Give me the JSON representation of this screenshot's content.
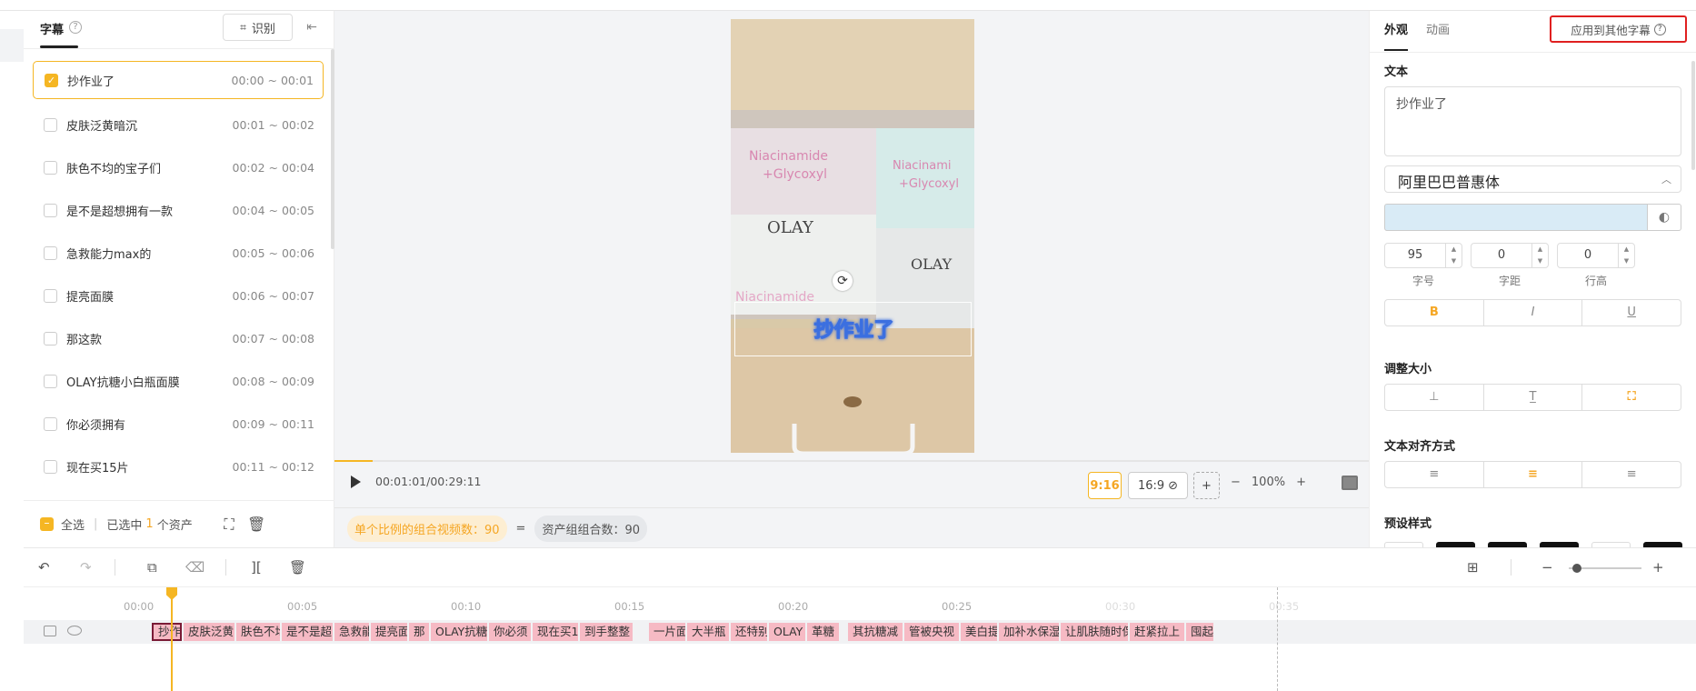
{
  "left_panel": {
    "title": "字幕",
    "help_icon": "?",
    "recognize_label": "识别",
    "items": [
      {
        "text": "抄作业了",
        "time": "00:00 ~ 00:01",
        "checked": true
      },
      {
        "text": "皮肤泛黄暗沉",
        "time": "00:01 ~ 00:02",
        "checked": false
      },
      {
        "text": "肤色不均的宝子们",
        "time": "00:02 ~ 00:04",
        "checked": false
      },
      {
        "text": "是不是超想拥有一款",
        "time": "00:04 ~ 00:05",
        "checked": false
      },
      {
        "text": "急救能力max的",
        "time": "00:05 ~ 00:06",
        "checked": false
      },
      {
        "text": "提亮面膜",
        "time": "00:06 ~ 00:07",
        "checked": false
      },
      {
        "text": "那这款",
        "time": "00:07 ~ 00:08",
        "checked": false
      },
      {
        "text": "OLAY抗糖小白瓶面膜",
        "time": "00:08 ~ 00:09",
        "checked": false
      },
      {
        "text": "你必须拥有",
        "time": "00:09 ~ 00:11",
        "checked": false
      },
      {
        "text": "现在买15片",
        "time": "00:11 ~ 00:12",
        "checked": false
      }
    ],
    "footer": {
      "select_all": "全选",
      "selected_prefix": "已选中",
      "selected_count": "1",
      "selected_suffix": "个资产"
    }
  },
  "preview": {
    "subtitle_text": "抄作业了",
    "timecode": "00:01:01/00:29:11",
    "ratios": [
      "9:16",
      "16:9"
    ],
    "zoom": "100%",
    "combo_label": "单个比例的组合视频数：90",
    "equals": "=",
    "group_label": "资产组组合数：90"
  },
  "right_panel": {
    "tabs": [
      "外观",
      "动画"
    ],
    "apply_label": "应用到其他字幕",
    "text_section": "文本",
    "text_value": "抄作业了",
    "font": "阿里巴巴普惠体",
    "color": "#d9ebf6",
    "spinners": [
      {
        "value": "95",
        "label": "字号"
      },
      {
        "value": "0",
        "label": "字距"
      },
      {
        "value": "0",
        "label": "行高"
      }
    ],
    "style_buttons": [
      "B",
      "I",
      "U"
    ],
    "resize_section": "调整大小",
    "align_section": "文本对齐方式",
    "preset_section": "预设样式"
  },
  "timeline": {
    "ticks": [
      "00:00",
      "00:05",
      "00:10",
      "00:15",
      "00:20",
      "00:25",
      "00:30",
      "00:35"
    ],
    "clips": [
      "抄作",
      "皮肤泛黄",
      "肤色不均",
      "是不是超",
      "急救能",
      "提亮面",
      "那",
      "OLAY抗糖",
      "你必须",
      "现在买1",
      "到手整整",
      "一片面",
      "大半瓶",
      "还特别",
      "OLAY",
      "革糖",
      "其抗糖减",
      "管被央视",
      "美白提",
      "加补水保湿",
      "让肌肤随时保",
      "赶紧拉上",
      "囤起"
    ]
  }
}
